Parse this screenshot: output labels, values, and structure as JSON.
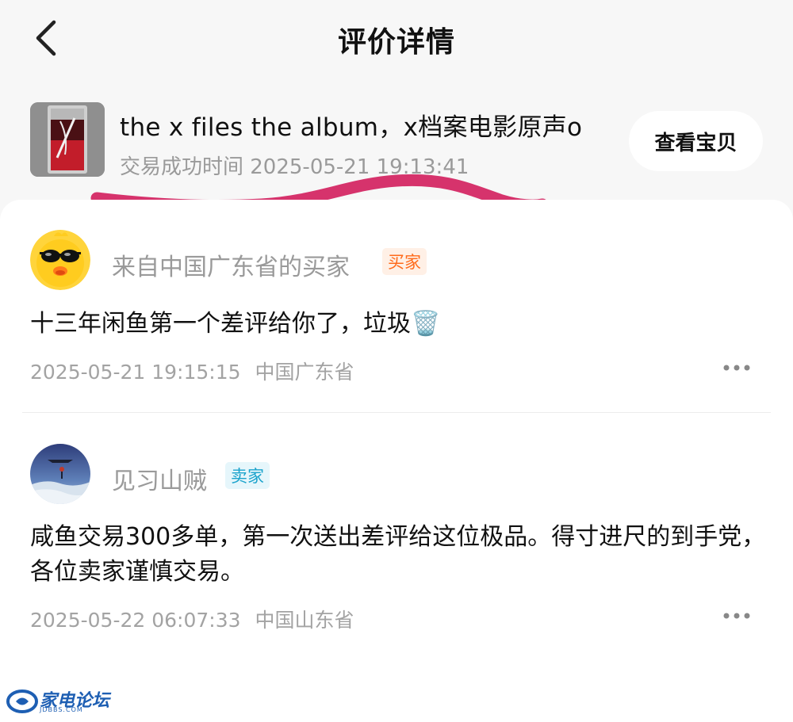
{
  "header": {
    "title": "评价详情",
    "back_icon": "chevron-left-icon"
  },
  "product": {
    "name": "the x files the album，x档案电影原声o",
    "trade_time": "交易成功时间 2025-05-21 19:13:41",
    "view_button_label": "查看宝贝"
  },
  "annotation": {
    "underline_color": "#d6336c"
  },
  "comments": [
    {
      "username": "来自中国广东省的买家",
      "role": "买家",
      "text": "十三年闲鱼第一个差评给你了，垃圾🗑️",
      "timestamp": "2025-05-21 19:15:15",
      "location": "中国广东省",
      "more_icon": "more-horizontal-icon"
    },
    {
      "username": "见习山贼",
      "role": "卖家",
      "text": "咸鱼交易300多单，第一次送出差评给这位极品。得寸进尺的到手党，各位卖家谨慎交易。",
      "timestamp": "2025-05-22 06:07:33",
      "location": "中国山东省",
      "more_icon": "more-horizontal-icon"
    }
  ],
  "watermark": {
    "text": "家电论坛",
    "sub": "JDBBS.COM"
  },
  "colors": {
    "buyer_badge_text": "#ff6a1a",
    "buyer_badge_bg": "#fff0e6",
    "seller_badge_text": "#1aa3cc",
    "seller_badge_bg": "#e6f6fb",
    "meta_gray": "#a3a3a3"
  }
}
